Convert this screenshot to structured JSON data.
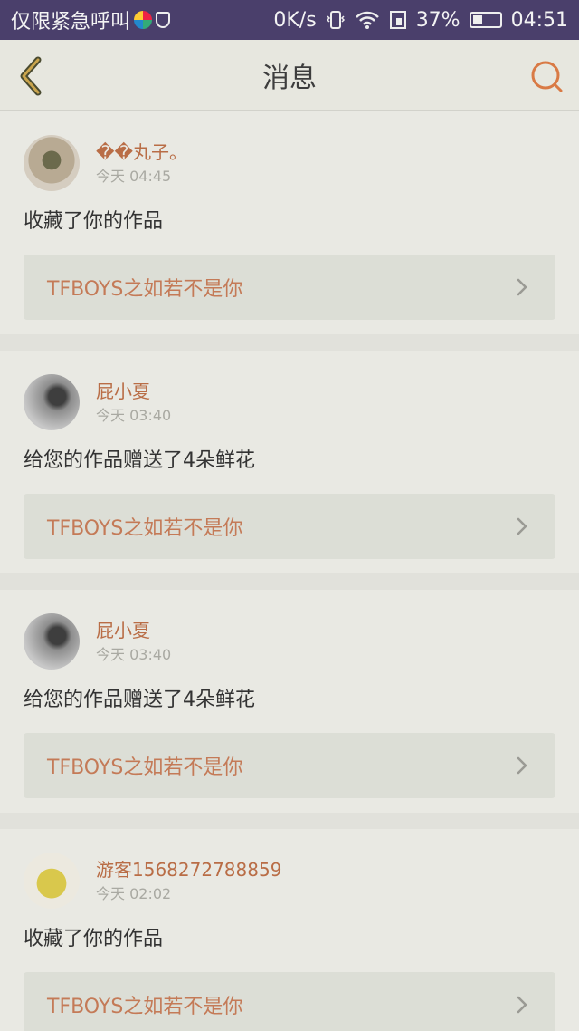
{
  "status_bar": {
    "left_text": "仅限紧急呼叫",
    "network_speed": "0K/s",
    "battery": "37%",
    "time": "04:51",
    "battery_level": 0.37
  },
  "header": {
    "title": "消息",
    "accent_color": "#d97a45"
  },
  "messages": [
    {
      "username": "��丸子。",
      "time": "今天 04:45",
      "action": "收藏了你的作品",
      "work_title": "TFBOYS之如若不是你"
    },
    {
      "username": "屁小夏",
      "time": "今天 03:40",
      "action": "给您的作品赠送了4朵鲜花",
      "work_title": "TFBOYS之如若不是你"
    },
    {
      "username": "屁小夏",
      "time": "今天 03:40",
      "action": "给您的作品赠送了4朵鲜花",
      "work_title": "TFBOYS之如若不是你"
    },
    {
      "username": "游客1568272788859",
      "time": "今天 02:02",
      "action": "收藏了你的作品",
      "work_title": "TFBOYS之如若不是你"
    }
  ]
}
